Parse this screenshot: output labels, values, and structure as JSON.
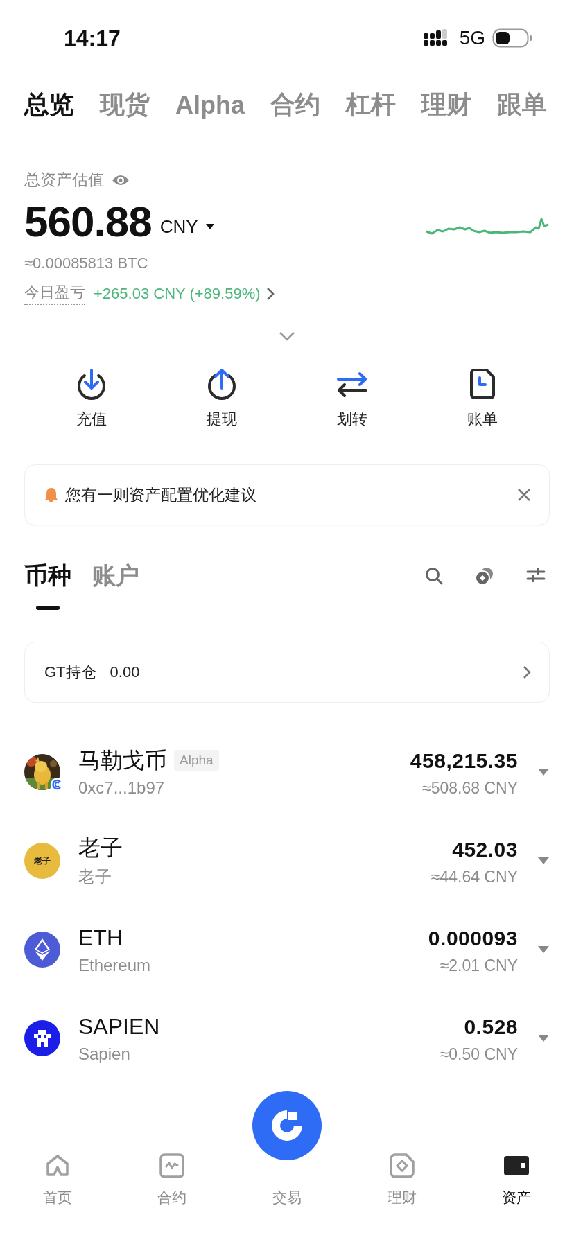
{
  "status_bar": {
    "time": "14:17",
    "network": "5G"
  },
  "tabs": [
    {
      "label": "总览",
      "selected": true
    },
    {
      "label": "现货",
      "selected": false
    },
    {
      "label": "Alpha",
      "selected": false
    },
    {
      "label": "合约",
      "selected": false
    },
    {
      "label": "杠杆",
      "selected": false
    },
    {
      "label": "理财",
      "selected": false
    },
    {
      "label": "跟单",
      "selected": false
    }
  ],
  "overview": {
    "label": "总资产估值",
    "total": "560.88",
    "currency": "CNY",
    "btc": "≈0.00085813 BTC",
    "pnl_label": "今日盈亏",
    "pnl_value": "+265.03 CNY (+89.59%)"
  },
  "actions": [
    {
      "label": "充值",
      "kind": "deposit"
    },
    {
      "label": "提现",
      "kind": "withdraw"
    },
    {
      "label": "划转",
      "kind": "transfer"
    },
    {
      "label": "账单",
      "kind": "bill"
    }
  ],
  "notice": {
    "text": "您有一则资产配置优化建议"
  },
  "asset_tabs": [
    {
      "label": "币种",
      "selected": true
    },
    {
      "label": "账户",
      "selected": false
    }
  ],
  "gt_holding": {
    "label": "GT持仓",
    "value": "0.00"
  },
  "coins": [
    {
      "kind": "picture",
      "name": "马勒戈币",
      "tag": "Alpha",
      "sub": "0xc7...1b97",
      "amount": "458,215.35",
      "value": "≈508.68 CNY"
    },
    {
      "kind": "text-logo",
      "logo_text": "老子",
      "name": "老子",
      "sub": "老子",
      "amount": "452.03",
      "value": "≈44.64 CNY"
    },
    {
      "kind": "eth",
      "name": "ETH",
      "sub": "Ethereum",
      "amount": "0.000093",
      "value": "≈2.01 CNY"
    },
    {
      "kind": "sapien",
      "name": "SAPIEN",
      "sub": "Sapien",
      "amount": "0.528",
      "value": "≈0.50 CNY"
    }
  ],
  "nav": [
    {
      "label": "首页",
      "kind": "home",
      "selected": false
    },
    {
      "label": "合约",
      "kind": "futures",
      "selected": false
    },
    {
      "label": "交易",
      "kind": "trade",
      "selected": false
    },
    {
      "label": "理财",
      "kind": "earn",
      "selected": false
    },
    {
      "label": "资产",
      "kind": "assets",
      "selected": true
    }
  ]
}
